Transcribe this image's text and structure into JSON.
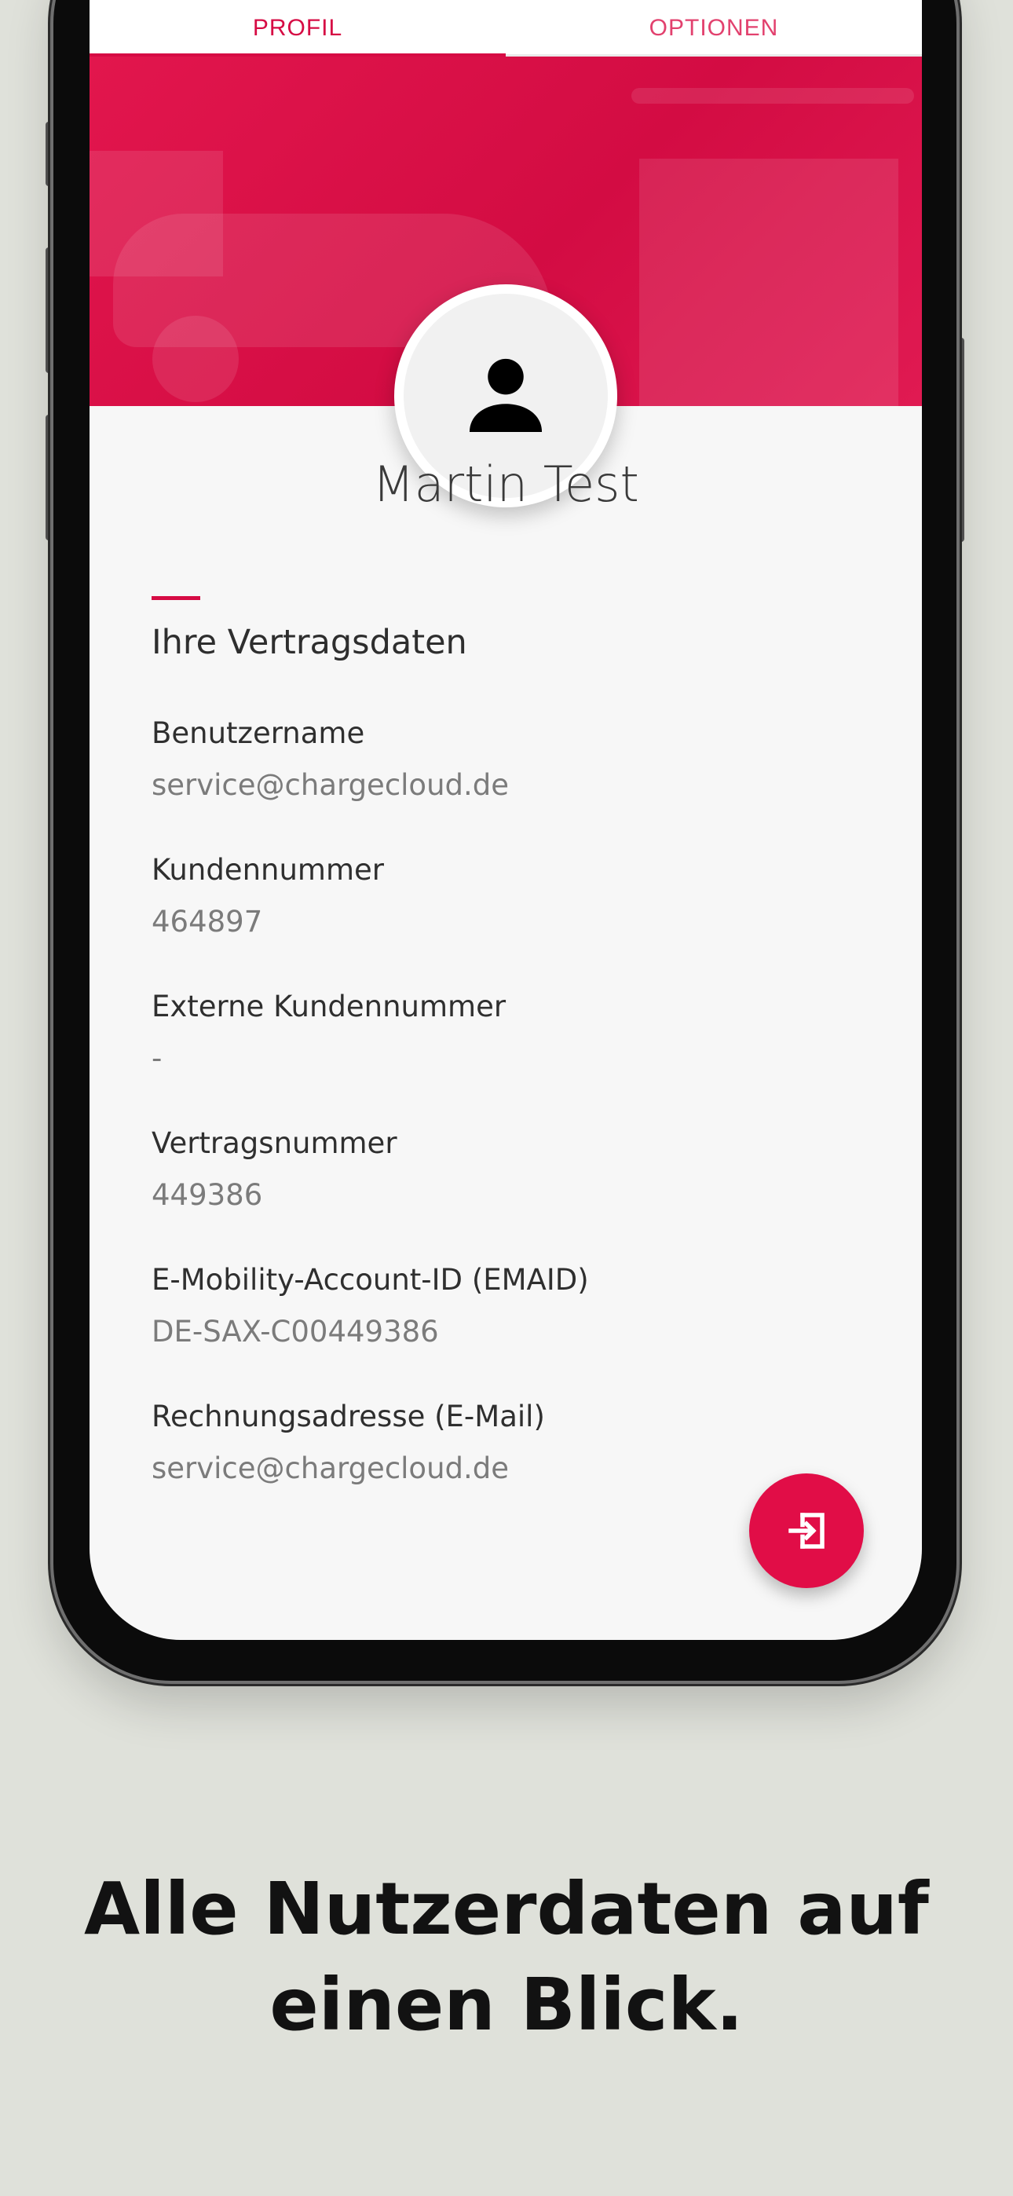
{
  "tabs": [
    {
      "label": "PROFIL",
      "active": true
    },
    {
      "label": "OPTIONEN",
      "active": false
    }
  ],
  "profile": {
    "name": "Martin Test",
    "avatar_icon": "person-icon"
  },
  "contract": {
    "section_title": "Ihre Vertragsdaten",
    "fields": [
      {
        "label": "Benutzername",
        "value": "service@chargecloud.de"
      },
      {
        "label": "Kundennummer",
        "value": "464897"
      },
      {
        "label": "Externe Kundennummer",
        "value": "-"
      },
      {
        "label": "Vertragsnummer",
        "value": "449386"
      },
      {
        "label": "E-Mobility-Account-ID (EMAID)",
        "value": "DE-SAX-C00449386"
      },
      {
        "label": "Rechnungsadresse (E-Mail)",
        "value": "service@chargecloud.de"
      }
    ]
  },
  "fab": {
    "icon": "logout-icon"
  },
  "caption": "Alle Nutzerdaten auf einen Blick.",
  "colors": {
    "accent": "#d60b44",
    "background": "#dfe1da"
  }
}
